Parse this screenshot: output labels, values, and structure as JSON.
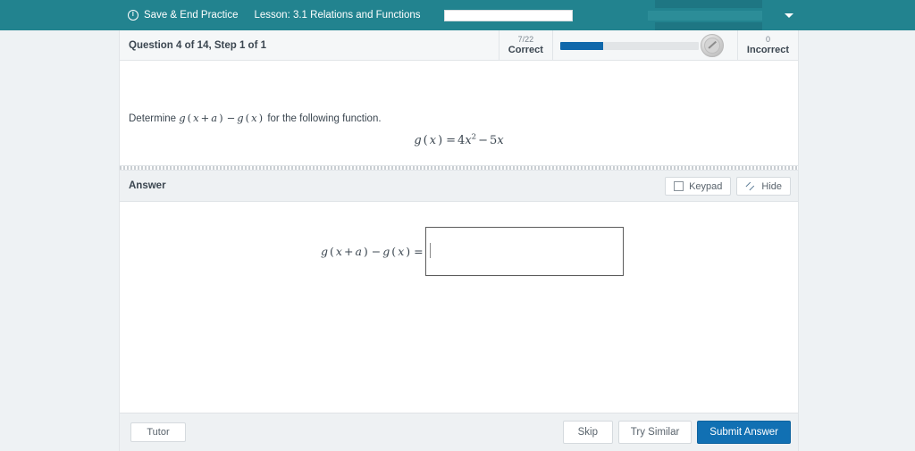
{
  "topbar": {
    "save_end_label": "Save & End Practice",
    "power_icon": "power-icon",
    "lesson_label": "Lesson: 3.1 Relations and Functions",
    "url_field_value": "",
    "caret_icon": "chevron-down-icon",
    "background_color": "#22838f"
  },
  "question_header": {
    "title": "Question 4 of 14,  Step 1 of 1",
    "correct_count": "7/22",
    "correct_label": "Correct",
    "incorrect_count": "0",
    "incorrect_label": "Incorrect",
    "progress_percent": 31,
    "progress_fill_color": "#1068ab",
    "gauge_icon": "gauge-icon"
  },
  "question": {
    "prompt_prefix": "Determine ",
    "prompt_expr_g": "g",
    "prompt_open": "(",
    "prompt_x": "x",
    "prompt_plus": "+",
    "prompt_a": "a",
    "prompt_close": ")",
    "prompt_minus": "−",
    "prompt_suffix": " for the following function.",
    "formula_fn": "g",
    "formula_var": "x",
    "formula_eq": "=",
    "formula_coef": "4",
    "formula_exp": "2",
    "formula_minus": "−",
    "formula_lin_coef": "5"
  },
  "answer_section": {
    "label": "Answer",
    "keypad_label": "Keypad",
    "keypad_icon": "keypad-icon",
    "hide_label": "Hide",
    "hide_icon": "collapse-arrows-icon",
    "answer_lhs_fn": "g",
    "answer_lhs_x": "x",
    "answer_lhs_plus": "+",
    "answer_lhs_a": "a",
    "answer_lhs_minus": "−",
    "answer_lhs_eq": "=",
    "answer_value": "",
    "answer_placeholder": ""
  },
  "footer": {
    "tutor_label": "Tutor",
    "skip_label": "Skip",
    "try_similar_label": "Try Similar",
    "submit_label": "Submit Answer",
    "submit_color": "#1170b3"
  }
}
